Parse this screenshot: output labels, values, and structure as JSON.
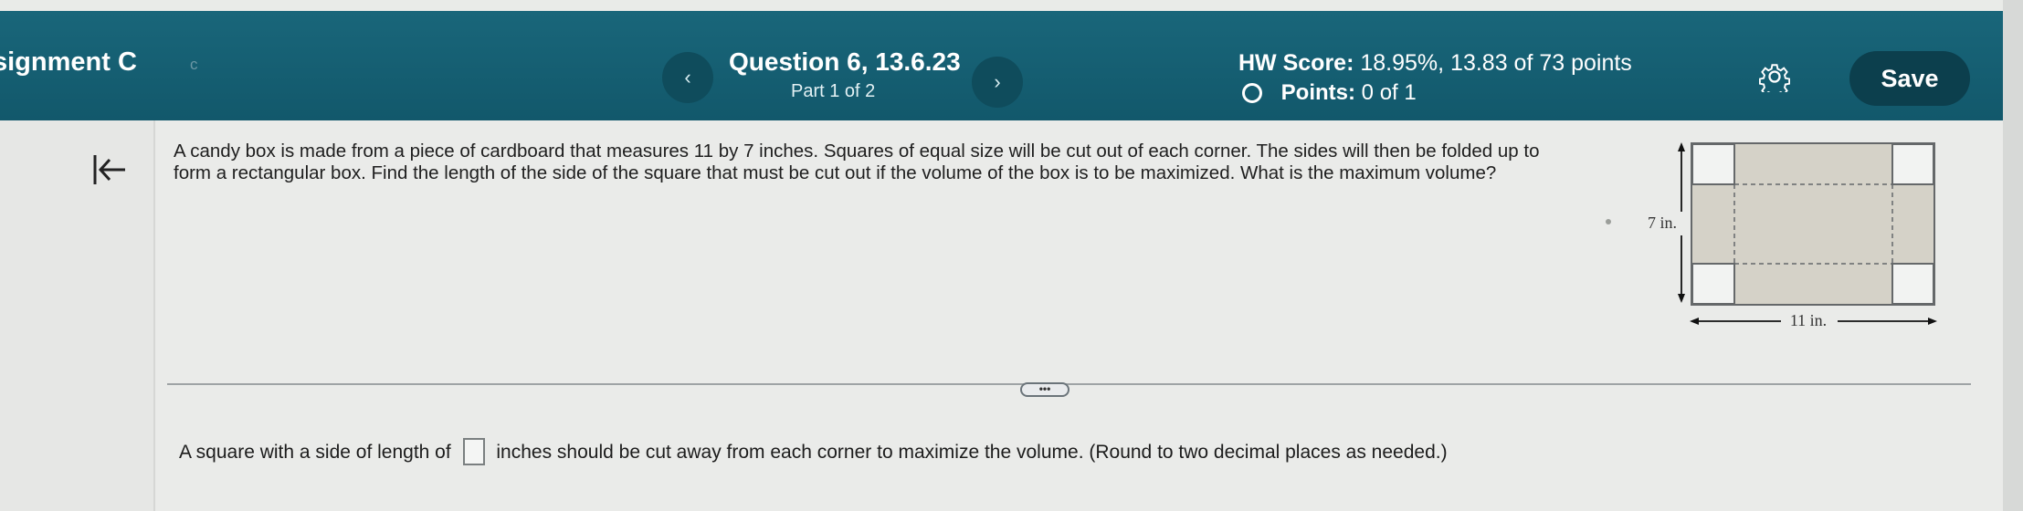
{
  "header": {
    "assignment_title": "signment C",
    "dot": "c",
    "prev_label": "‹",
    "next_label": "›",
    "question_title": "Question 6, 13.6.23",
    "part_label": "Part 1 of 2",
    "hw_score_label": "HW Score:",
    "hw_score_value": "18.95%, 13.83 of 73 points",
    "points_label": "Points:",
    "points_value": "0 of 1",
    "save_label": "Save"
  },
  "question": {
    "text": "A candy box is made from a piece of cardboard that measures 11 by 7 inches. Squares of equal size will be cut out of each corner. The sides will then be folded up to form a rectangular box. Find the length of the side of the square that must be cut out if the volume of the box is to be maximized. What is the maximum volume?",
    "diagram": {
      "height_label": "7 in.",
      "width_label": "11 in."
    },
    "more_label": "•••"
  },
  "answer": {
    "prefix": "A square with a side of length of",
    "suffix": "inches should be cut away from each corner to maximize the volume. (Round to two decimal places as needed.)",
    "value": ""
  },
  "icons": {
    "settings": "gear-icon",
    "collapse": "collapse-left-icon",
    "status": "circle-outline-icon"
  },
  "colors": {
    "header": "#12586b",
    "nav_button": "#0f4c5c",
    "save_button": "#0c3f4d",
    "page": "#eaebe9"
  }
}
